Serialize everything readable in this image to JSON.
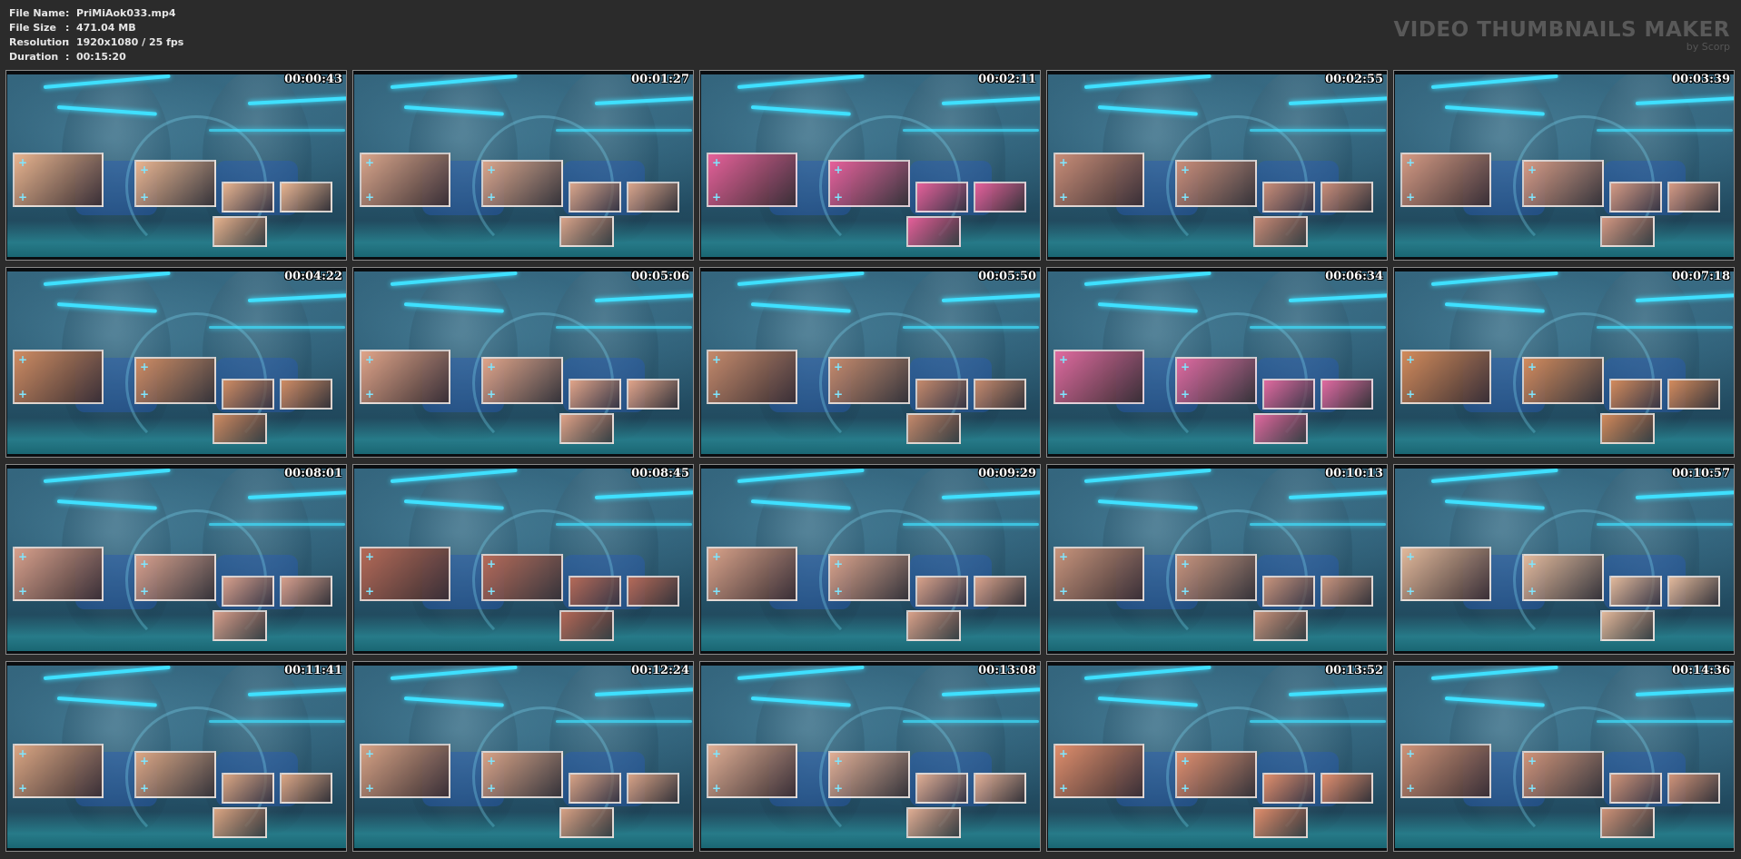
{
  "info": {
    "rows": [
      {
        "key": "File Name",
        "sep": ":",
        "value": "PriMiAok033.mp4"
      },
      {
        "key": "File Size",
        "sep": ":",
        "value": "471.04 MB"
      },
      {
        "key": "Resolution",
        "sep": ":",
        "value": "1920x1080 / 25 fps"
      },
      {
        "key": "Duration",
        "sep": ":",
        "value": "00:15:20"
      }
    ]
  },
  "brand": {
    "title": "VIDEO THUMBNAILS MAKER",
    "subtitle": "by Scorp"
  },
  "thumbnails": [
    {
      "timestamp": "00:00:43",
      "tint": "#e8b48f"
    },
    {
      "timestamp": "00:01:27",
      "tint": "#d9a58b"
    },
    {
      "timestamp": "00:02:11",
      "tint": "#e6609a"
    },
    {
      "timestamp": "00:02:55",
      "tint": "#c98d78"
    },
    {
      "timestamp": "00:03:39",
      "tint": "#d59a84"
    },
    {
      "timestamp": "00:04:22",
      "tint": "#cf8c63"
    },
    {
      "timestamp": "00:05:06",
      "tint": "#e0a489"
    },
    {
      "timestamp": "00:05:50",
      "tint": "#c58a6c"
    },
    {
      "timestamp": "00:06:34",
      "tint": "#e06aa0"
    },
    {
      "timestamp": "00:07:18",
      "tint": "#d38b5c"
    },
    {
      "timestamp": "00:08:01",
      "tint": "#d8a08c"
    },
    {
      "timestamp": "00:08:45",
      "tint": "#b56a58"
    },
    {
      "timestamp": "00:09:29",
      "tint": "#d9a28a"
    },
    {
      "timestamp": "00:10:13",
      "tint": "#c8947c"
    },
    {
      "timestamp": "00:10:57",
      "tint": "#e2b99b"
    },
    {
      "timestamp": "00:11:41",
      "tint": "#dba683"
    },
    {
      "timestamp": "00:12:24",
      "tint": "#d7a285"
    },
    {
      "timestamp": "00:13:08",
      "tint": "#e0ae94"
    },
    {
      "timestamp": "00:13:52",
      "tint": "#e08e6c"
    },
    {
      "timestamp": "00:14:36",
      "tint": "#cf9378"
    }
  ],
  "colors": {
    "background": "#2b2b2b",
    "border": "#8a8a8a",
    "accent_beam": "#3fe0ff"
  }
}
